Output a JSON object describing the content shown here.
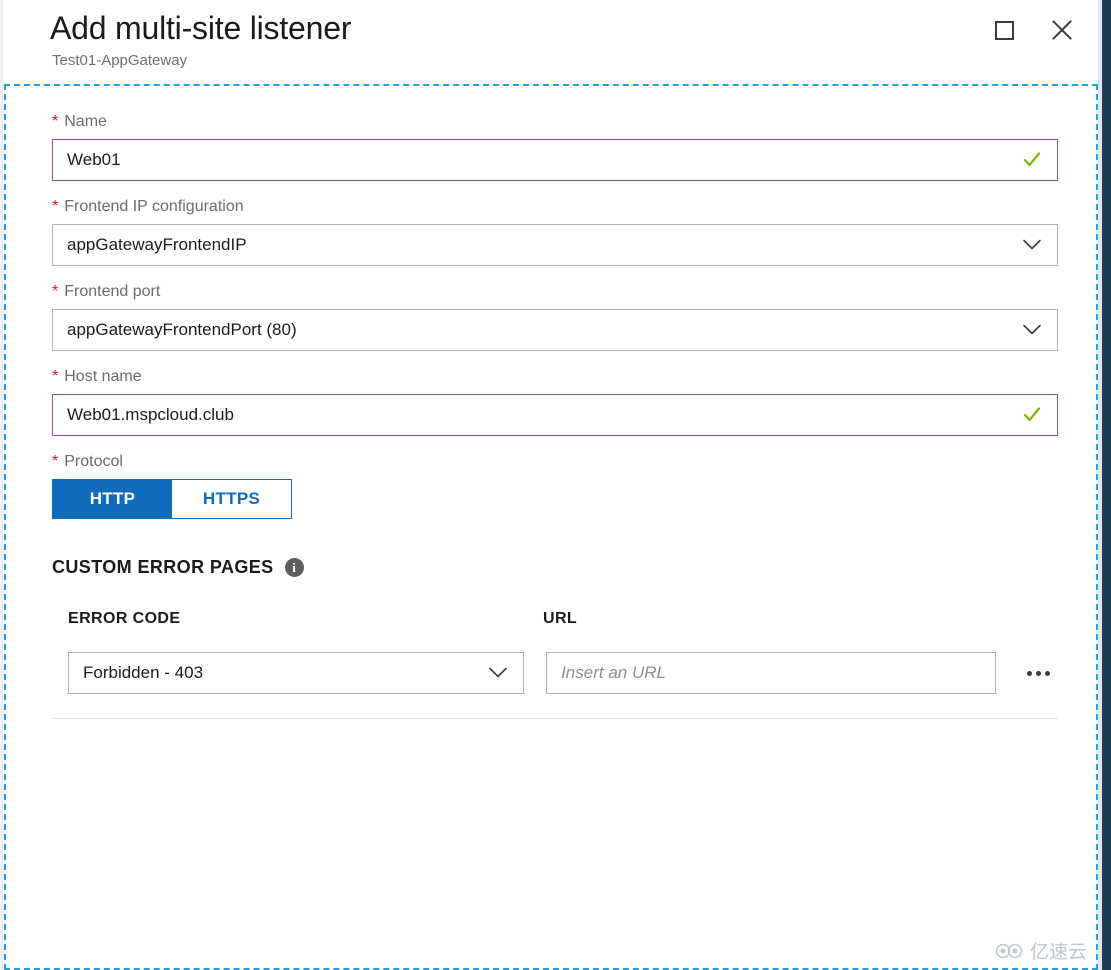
{
  "header": {
    "title": "Add multi-site listener",
    "subtitle": "Test01-AppGateway",
    "maximize_label": "Maximize",
    "close_label": "Close"
  },
  "colors": {
    "accent_blue": "#0f6cbd",
    "focus_dash": "#1ba1e2",
    "valid_border": "#9b4f96",
    "required_star": "#e81123",
    "check_green": "#7db700",
    "blade_edge": "#1f3a54"
  },
  "form": {
    "name": {
      "label": "Name",
      "required_marker": "*",
      "value": "Web01",
      "placeholder": "",
      "validation": "valid"
    },
    "frontend_ip": {
      "label": "Frontend IP configuration",
      "required_marker": "*",
      "value": "appGatewayFrontendIP"
    },
    "frontend_port": {
      "label": "Frontend port",
      "required_marker": "*",
      "value": "appGatewayFrontendPort (80)"
    },
    "host_name": {
      "label": "Host name",
      "required_marker": "*",
      "value": "Web01.mspcloud.club",
      "placeholder": "",
      "validation": "valid"
    },
    "protocol": {
      "label": "Protocol",
      "required_marker": "*",
      "options": [
        "HTTP",
        "HTTPS"
      ],
      "selected": "HTTP"
    }
  },
  "custom_error_pages": {
    "section_title": "CUSTOM ERROR PAGES",
    "info_glyph": "i",
    "columns": [
      "ERROR CODE",
      "URL"
    ],
    "rows": [
      {
        "error_code": "Forbidden - 403",
        "url_value": "",
        "url_placeholder": "Insert an URL",
        "more_label": "More options"
      }
    ]
  },
  "watermark": {
    "text": "亿速云"
  }
}
